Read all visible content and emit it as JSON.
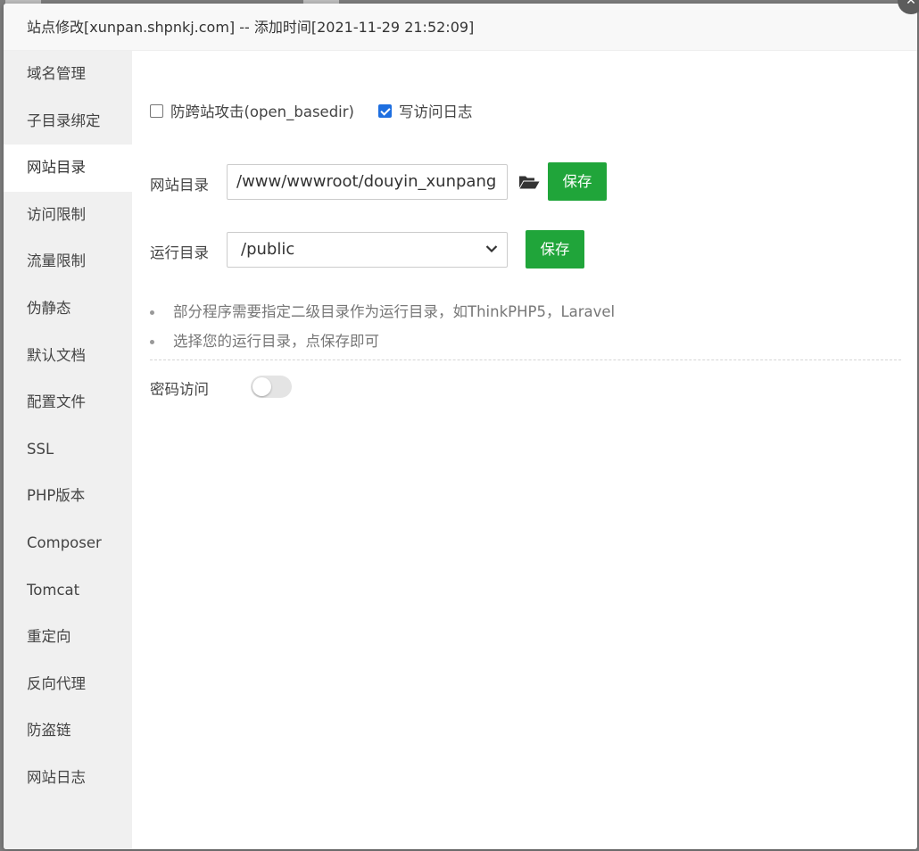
{
  "dialog": {
    "title": "站点修改[xunpan.shpnkj.com] -- 添加时间[2021-11-29 21:52:09]",
    "close_icon": "close-icon"
  },
  "sidebar": {
    "active_index": 2,
    "items": [
      {
        "label": "域名管理"
      },
      {
        "label": "子目录绑定"
      },
      {
        "label": "网站目录"
      },
      {
        "label": "访问限制"
      },
      {
        "label": "流量限制"
      },
      {
        "label": "伪静态"
      },
      {
        "label": "默认文档"
      },
      {
        "label": "配置文件"
      },
      {
        "label": "SSL"
      },
      {
        "label": "PHP版本"
      },
      {
        "label": "Composer"
      },
      {
        "label": "Tomcat"
      },
      {
        "label": "重定向"
      },
      {
        "label": "反向代理"
      },
      {
        "label": "防盗链"
      },
      {
        "label": "网站日志"
      }
    ]
  },
  "main": {
    "options": {
      "anti_xss": {
        "label": "防跨站攻击(open_basedir)",
        "checked": false
      },
      "access_log": {
        "label": "写访问日志",
        "checked": true
      }
    },
    "site_dir": {
      "label": "网站目录",
      "value": "/www/wwwroot/douyin_xunpang",
      "folder_icon": "folder-open-icon",
      "save_label": "保存"
    },
    "run_dir": {
      "label": "运行目录",
      "selected": "/public",
      "arrow_icon": "chevron-down-icon",
      "save_label": "保存"
    },
    "tips": [
      "部分程序需要指定二级目录作为运行目录，如ThinkPHP5，Laravel",
      "选择您的运行目录，点保存即可"
    ],
    "password_access": {
      "label": "密码访问",
      "enabled": false
    }
  },
  "colors": {
    "accent_green": "#20a53a",
    "checkbox_blue": "#1e6fe0",
    "sidebar_bg": "#f0f0f0"
  }
}
